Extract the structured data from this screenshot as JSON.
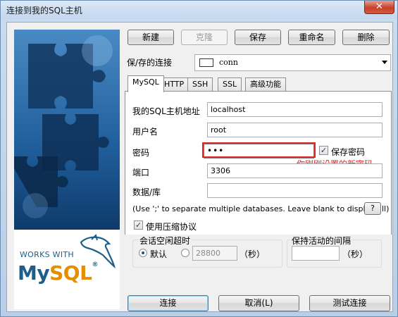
{
  "window": {
    "title": "连接到我的SQL主机",
    "close_glyph": "✕"
  },
  "banner": {
    "works_with": "WORKS WITH",
    "logo_my": "My",
    "logo_sql": "SQL",
    "logo_mark": "®"
  },
  "toolbar": {
    "new": "新建",
    "clone": "克隆",
    "save": "保存",
    "rename": "重命名",
    "delete": "删除"
  },
  "saved": {
    "label": "保/存的连接",
    "value": "conn"
  },
  "tabs": [
    "MySQL",
    "HTTP",
    "SSH",
    "SSL",
    "高级功能"
  ],
  "form": {
    "host_label": "我的SQL主机地址",
    "host_value": "localhost",
    "user_label": "用户名",
    "user_value": "root",
    "password_label": "密码",
    "password_value": "•••",
    "save_password_label": "保存密码",
    "port_label": "端口",
    "port_value": "3306",
    "db_label": "数据/库",
    "db_value": "",
    "db_hint": "(Use ';' to separate multiple databases. Leave blank to display all)",
    "help": "?",
    "compress_label": "使用压缩协议"
  },
  "annotation": "你刚刚设置的新密码",
  "idle": {
    "title": "会话空闲超时",
    "default_label": "默认",
    "custom_value": "28800",
    "unit": "（秒）"
  },
  "keepalive": {
    "title": "保持活动的间隔",
    "value": "",
    "unit": "（秒）"
  },
  "footer": {
    "connect": "连接",
    "cancel": "取消(L)",
    "test": "测试连接"
  }
}
